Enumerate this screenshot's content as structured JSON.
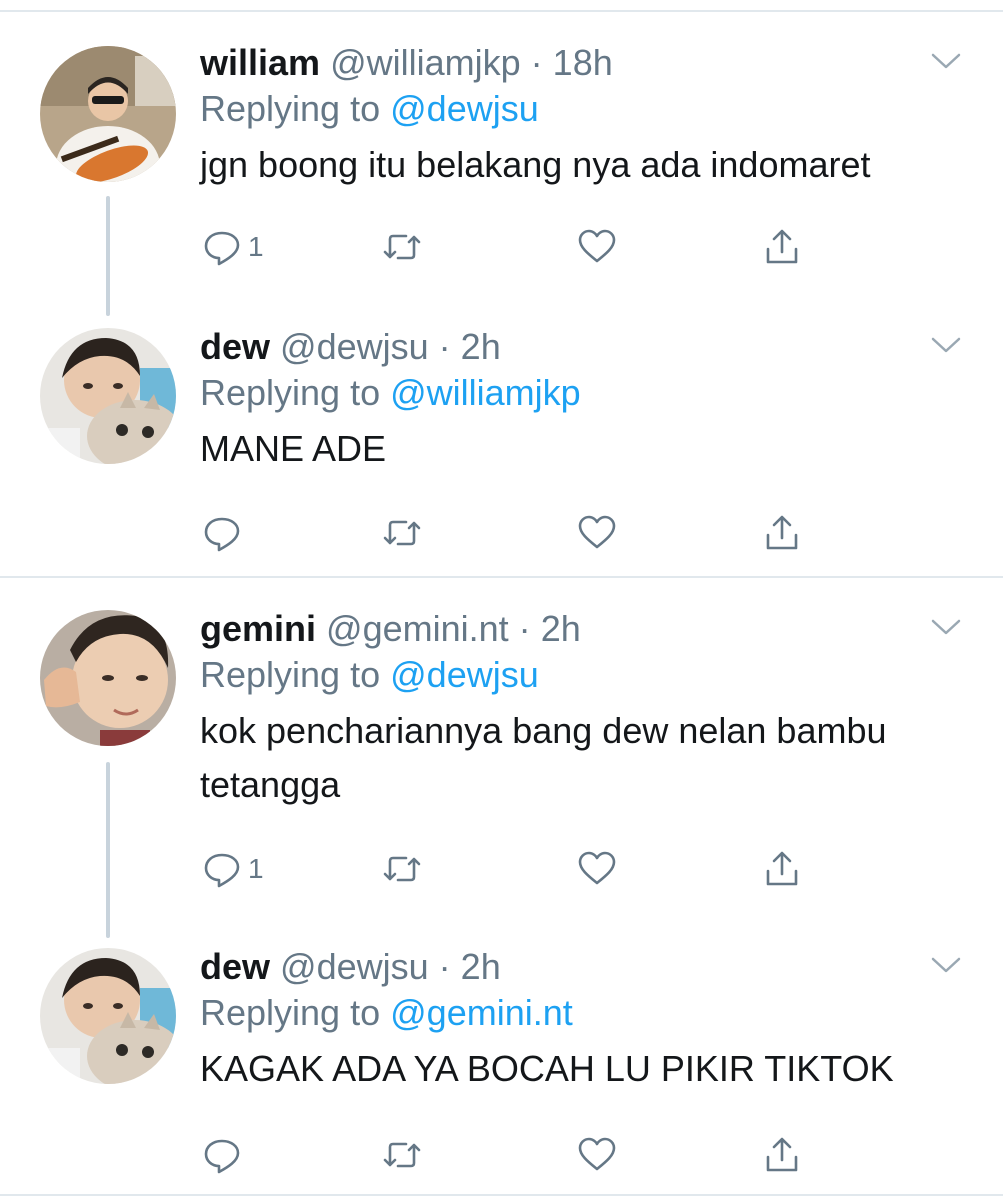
{
  "tweets": [
    {
      "name": "william",
      "handle": "@williamjkp",
      "separator": "·",
      "time": "18h",
      "replying_label": "Replying to",
      "reply_to": "@dewjsu",
      "text": "jgn boong itu belakang nya ada indomaret",
      "reply_count": "1"
    },
    {
      "name": "dew",
      "handle": "@dewjsu",
      "separator": "·",
      "time": "2h",
      "replying_label": "Replying to",
      "reply_to": "@williamjkp",
      "text": "MANE ADE",
      "reply_count": ""
    },
    {
      "name": "gemini",
      "handle": "@gemini.nt",
      "separator": "·",
      "time": "2h",
      "replying_label": "Replying to",
      "reply_to": "@dewjsu",
      "text": "kok penchariannya bang dew nelan bambu tetangga",
      "reply_count": "1"
    },
    {
      "name": "dew",
      "handle": "@dewjsu",
      "separator": "·",
      "time": "2h",
      "replying_label": "Replying to",
      "reply_to": "@gemini.nt",
      "text": "KAGAK ADA YA BOCAH LU PIKIR TIKTOK",
      "reply_count": ""
    }
  ],
  "icons": {
    "reply": "reply-icon",
    "retweet": "retweet-icon",
    "like": "heart-icon",
    "share": "share-icon",
    "more": "chevron-down-icon"
  },
  "colors": {
    "mention": "#1da1f2",
    "secondary_text": "#657786",
    "icon": "#657786",
    "divider": "#e1e8ed",
    "thread_line": "#c8d3dc"
  }
}
